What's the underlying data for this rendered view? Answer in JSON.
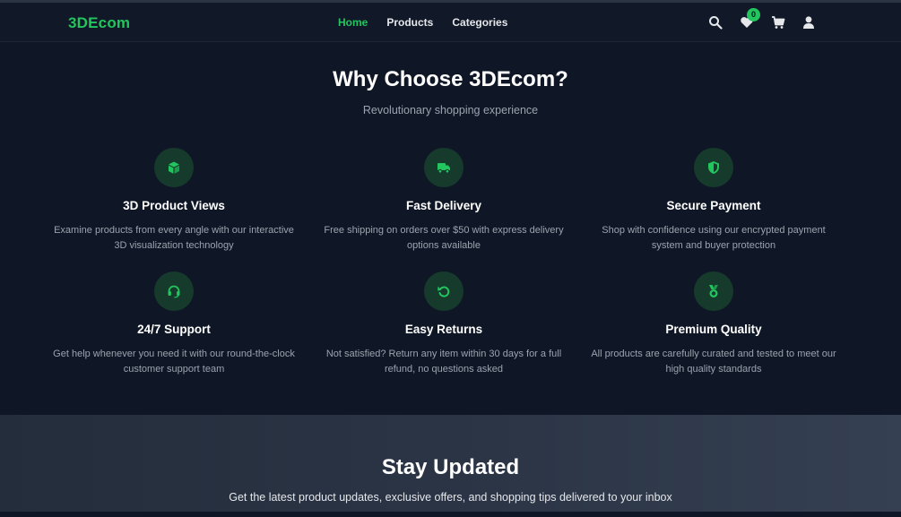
{
  "navbar": {
    "brand": "3DEcom",
    "links": [
      {
        "label": "Home",
        "active": true
      },
      {
        "label": "Products",
        "active": false
      },
      {
        "label": "Categories",
        "active": false
      }
    ],
    "wishlist_count": "0",
    "icons": [
      "search-icon",
      "heart-icon",
      "cart-icon",
      "user-icon"
    ]
  },
  "features_section": {
    "title": "Why Choose 3DEcom?",
    "subtitle": "Revolutionary shopping experience",
    "items": [
      {
        "icon": "cube-icon",
        "title": "3D Product Views",
        "desc": "Examine products from every angle with our interactive 3D visualization technology"
      },
      {
        "icon": "truck-icon",
        "title": "Fast Delivery",
        "desc": "Free shipping on orders over $50 with express delivery options available"
      },
      {
        "icon": "shield-icon",
        "title": "Secure Payment",
        "desc": "Shop with confidence using our encrypted payment system and buyer protection"
      },
      {
        "icon": "headset-icon",
        "title": "24/7 Support",
        "desc": "Get help whenever you need it with our round-the-clock customer support team"
      },
      {
        "icon": "undo-icon",
        "title": "Easy Returns",
        "desc": "Not satisfied? Return any item within 30 days for a full refund, no questions asked"
      },
      {
        "icon": "medal-icon",
        "title": "Premium Quality",
        "desc": "All products are carefully curated and tested to meet our high quality standards"
      }
    ]
  },
  "newsletter": {
    "title": "Stay Updated",
    "subtitle": "Get the latest product updates, exclusive offers, and shopping tips delivered to your inbox"
  },
  "colors": {
    "accent": "#22c55e",
    "background": "#0f1726",
    "navbar": "#111827",
    "icon_circle": "#163a2c",
    "muted_text": "#9ca3af"
  }
}
